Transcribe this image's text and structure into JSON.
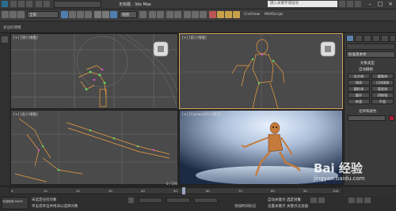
{
  "titlebar": {
    "title": "无标题 - 3ds Max",
    "search_placeholder": "键入关键字或短语"
  },
  "toolbar": {
    "selection_filter": "全部",
    "view_dropdown": "视图",
    "menu_labels": [
      "CivilView",
      "MAXScript"
    ]
  },
  "ribbon": {
    "label": "多边形建模"
  },
  "viewports": {
    "top_left": "[+] [顶] [线框]",
    "top_right": "[+] [前] [线框]",
    "bottom_left": "[+] [左] [线框]",
    "bottom_right": "[+] [Camera01] [真实]"
  },
  "command_panel": {
    "name_field": "标准基本体",
    "section_object_type": "对象类型",
    "auto_grid": "自动栅格",
    "buttons": [
      "长方体",
      "圆锥体",
      "球体",
      "几何球体",
      "圆柱体",
      "管状体",
      "圆环",
      "四棱锥",
      "茶壶",
      "平面"
    ],
    "section_name_color": "名称和颜色"
  },
  "timeline": {
    "frame_counter": "0 / 100",
    "ticks": [
      "0",
      "10",
      "20",
      "30",
      "40",
      "50",
      "60",
      "70",
      "80",
      "90",
      "100"
    ]
  },
  "status": {
    "line1": "未选定任何对象",
    "line2": "单击或单击并拖动以选择对象",
    "add_time_tag": "添加时间标记",
    "auto_key": "自动关键点",
    "set_key": "设置关键点",
    "key_filter": "关键点过滤器",
    "selected": "选定对象",
    "welcome": "欢迎使用 MAXS"
  },
  "watermark": {
    "text": "Bai 经验",
    "url": "jingyan.baidu.com"
  },
  "colors": {
    "accent_orange": "#e8a13a",
    "wire_orange": "#f0a040",
    "wire_green": "#5fd35f",
    "camera_bg": "#aabdd8"
  }
}
